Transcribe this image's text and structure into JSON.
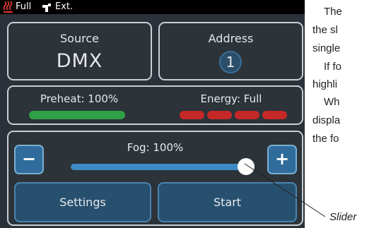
{
  "statusbar": {
    "heater_icon": "heater-icon",
    "fog_state": "Full",
    "control_icon": "hand-icon",
    "control_mode": "Ext."
  },
  "source": {
    "title": "Source",
    "value": "DMX"
  },
  "address": {
    "title": "Address",
    "value": "1"
  },
  "status": {
    "preheat_label": "Preheat: 100%",
    "preheat_level": 1.0,
    "energy_label": "Energy: Full",
    "energy_segments": 4,
    "colors": {
      "preheat": "#2fa046",
      "energy": "#c62828"
    }
  },
  "control": {
    "minus_label": "−",
    "plus_label": "+",
    "fog_label": "Fog: 100%",
    "fog_level": 1.0,
    "settings_label": "Settings",
    "start_label": "Start"
  },
  "doc_lines": [
    "The",
    "the sl",
    "single",
    "If fo",
    "highli",
    "Wh",
    "displa",
    "the fo"
  ],
  "callout": {
    "label": "Slider"
  }
}
